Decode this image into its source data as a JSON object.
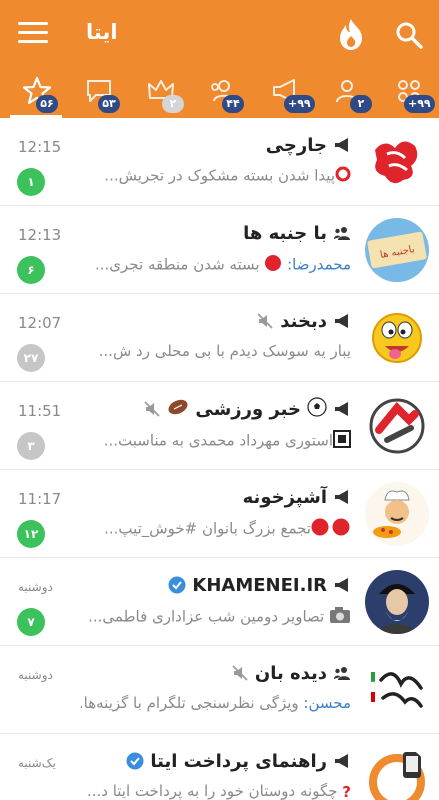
{
  "header": {
    "title": "ایتا",
    "icons": [
      "menu-icon",
      "fire-icon",
      "search-icon"
    ],
    "color": "#ef8a2f"
  },
  "tabs": [
    {
      "icon": "star-icon",
      "badge": "۵۶",
      "selected": true
    },
    {
      "icon": "chat-bubble-icon",
      "badge": "۵۳"
    },
    {
      "icon": "crown-icon",
      "badge": "۲",
      "badge_gray": true
    },
    {
      "icon": "group-icon",
      "badge": "۴۴"
    },
    {
      "icon": "megaphone-icon",
      "badge": "+۹۹"
    },
    {
      "icon": "person-icon",
      "badge": "۲"
    },
    {
      "icon": "grid-icon",
      "badge": "+۹۹"
    }
  ],
  "chats": [
    {
      "title": "جارچی",
      "type": "channel",
      "time": "12:15",
      "preview": "پیدا شدن بسته مشکوک در تجریش...",
      "unread": "۱",
      "muted": false
    },
    {
      "title": "با جنبه ها",
      "type": "group",
      "time": "12:13",
      "sender": "محمدرضا:",
      "preview": "بسته شدن منطقه تجری...",
      "unread": "۶",
      "muted": false
    },
    {
      "title": "دبخند",
      "type": "channel",
      "time": "12:07",
      "preview": "یبار یه سوسک دیدم با بی محلی رد ش...",
      "unread": "۲۷",
      "muted": true
    },
    {
      "title": "خبر ورزشی",
      "type": "channel",
      "time": "11:51",
      "preview": "استوری مهرداد محمدی به مناسبت...",
      "unread": "۳",
      "muted": true
    },
    {
      "title": "آشپزخونه",
      "type": "channel",
      "time": "11:17",
      "preview": "تجمع بزرگ بانوان #خوش_تیپ...",
      "unread": "۱۲",
      "muted": false
    },
    {
      "title": "KHAMENEI.IR",
      "type": "channel",
      "time": "دوشنبه",
      "preview": "تصاویر دومین شب عزاداری فاطمی...",
      "unread": "۷",
      "muted": false,
      "verified": true
    },
    {
      "title": "دیده بان",
      "type": "group",
      "time": "دوشنبه",
      "sender": "محسن:",
      "preview": "ویژگی نظرسنجی تلگرام با گزینه‌ها...",
      "muted": true
    },
    {
      "title": "راهنمای پرداخت ایتا",
      "type": "channel",
      "time": "یک‌شنبه",
      "preview": "چگونه دوستان خود را به پرداخت ایتا د...",
      "muted": false,
      "verified": true
    }
  ]
}
